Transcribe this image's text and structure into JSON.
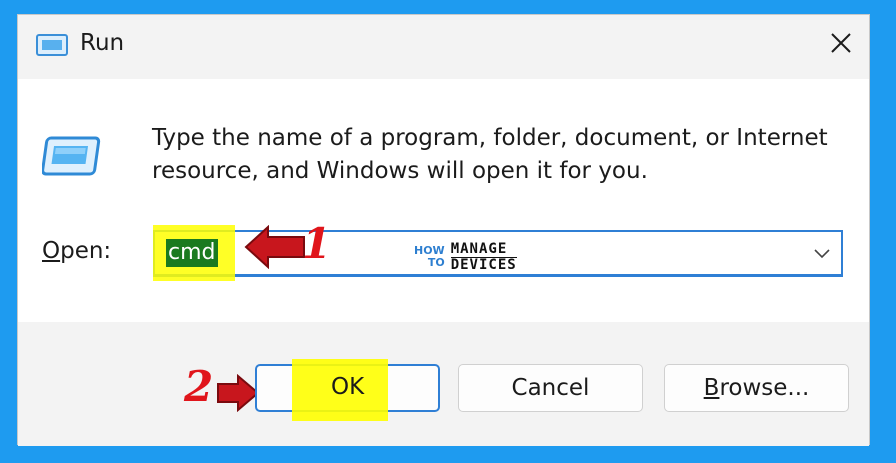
{
  "window": {
    "title": "Run",
    "close_icon": "close-icon",
    "app_icon": "run-icon"
  },
  "content": {
    "description": "Type the name of a program, folder, document, or Internet resource, and Windows will open it for you.",
    "open_label_prefix": "O",
    "open_label_suffix": "pen:",
    "open_value": "cmd",
    "watermark": {
      "how": "HOW",
      "to": "TO",
      "manage": "MANAGE",
      "devices": "DEVICES"
    }
  },
  "annotations": {
    "step1": "1",
    "step2": "2",
    "highlight_color": "#ffff00",
    "arrow_color": "#c8161d"
  },
  "buttons": {
    "ok": "OK",
    "cancel": "Cancel",
    "browse_prefix": "B",
    "browse_suffix": "rowse..."
  },
  "colors": {
    "background": "#1e9bf0",
    "accent": "#2f7fd5",
    "window": "#f3f3f3"
  }
}
